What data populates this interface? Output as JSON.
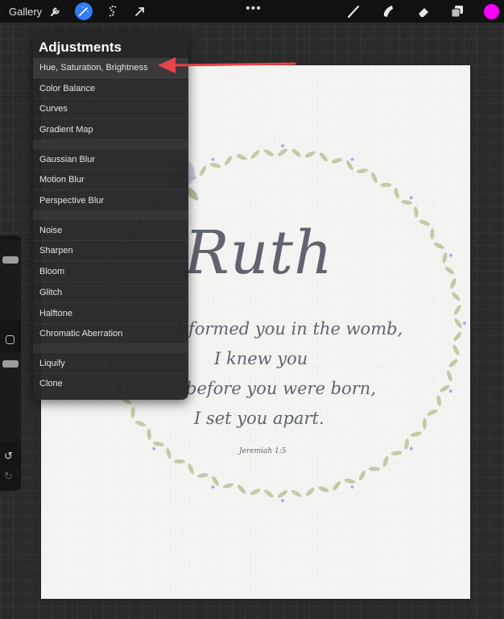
{
  "toolbar": {
    "gallery_label": "Gallery",
    "left_icons": [
      "wrench-icon",
      "magic-wand-icon",
      "selection-s-icon",
      "transform-arrow-icon"
    ],
    "more_glyph": "•••",
    "right_icons": [
      "brush-icon",
      "smudge-icon",
      "eraser-icon",
      "layers-icon"
    ],
    "color_swatch": "#ff00ff",
    "active_tool_color": "#2f7cf6"
  },
  "adjustments": {
    "title": "Adjustments",
    "groups": [
      [
        "Hue, Saturation, Brightness",
        "Color Balance",
        "Curves",
        "Gradient Map"
      ],
      [
        "Gaussian Blur",
        "Motion Blur",
        "Perspective Blur"
      ],
      [
        "Noise",
        "Sharpen",
        "Bloom",
        "Glitch",
        "Halftone",
        "Chromatic Aberration"
      ],
      [
        "Liquify",
        "Clone"
      ]
    ]
  },
  "canvas": {
    "title_text": "Ruth",
    "verse_lines": [
      "I formed you in the womb,",
      "I knew you",
      "before you were born,",
      "I set you apart."
    ],
    "reference": "Jeremiah 1:5"
  },
  "sidebar": {
    "undo_glyph": "↺",
    "redo_glyph": "↻"
  },
  "colors": {
    "annotation_arrow": "#e8424b",
    "wreath_leaf": "#b9c39a",
    "wreath_berry": "#b6a8e6",
    "lettering": "#5f6470"
  }
}
